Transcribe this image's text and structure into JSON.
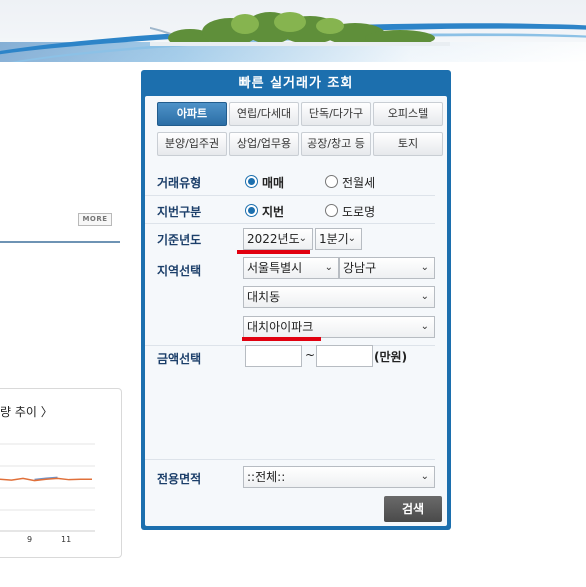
{
  "left": {
    "more_label": "MORE",
    "chart_title": "량 추이 〉",
    "chart_ticks": [
      "9",
      "11"
    ]
  },
  "chart_data": {
    "type": "line",
    "title": "",
    "x": [
      "",
      "",
      "",
      "",
      "",
      "9",
      "",
      "11",
      ""
    ],
    "series": [
      {
        "values": [
          0.5,
          0.48,
          0.52,
          0.47,
          0.5,
          0.52,
          0.49,
          0.5,
          0.5
        ]
      }
    ],
    "series_color": "#e0703a",
    "secondary_color": "#6e93c8"
  },
  "panel": {
    "title": "빠른 실거래가 조회",
    "tabs_row1": [
      "아파트",
      "연립/다세대",
      "단독/다가구",
      "오피스텔"
    ],
    "tabs_row2": [
      "분양/입주권",
      "상업/업무용",
      "공장/창고 등",
      "토지"
    ],
    "active_tab": "아파트",
    "deal_type": {
      "label": "거래유형",
      "options": [
        "매매",
        "전월세"
      ],
      "selected": "매매"
    },
    "lot_type": {
      "label": "지번구분",
      "options": [
        "지번",
        "도로명"
      ],
      "selected": "지번"
    },
    "year": {
      "label": "기준년도",
      "year_value": "2022년도",
      "quarter_value": "1분기"
    },
    "region": {
      "label": "지역선택",
      "city": "서울특별시",
      "district": "강남구",
      "dong": "대치동",
      "complex": "대치아이파크"
    },
    "price": {
      "label": "금액선택",
      "separator": "~",
      "unit": "(만원)",
      "min_value": "",
      "max_value": ""
    },
    "area": {
      "label": "전용면적",
      "value": "::전체::"
    },
    "search_button": "검색"
  },
  "colors": {
    "panel_blue": "#1c6fae",
    "label_navy": "#1c3f6a",
    "highlight_red": "#e1000f"
  }
}
